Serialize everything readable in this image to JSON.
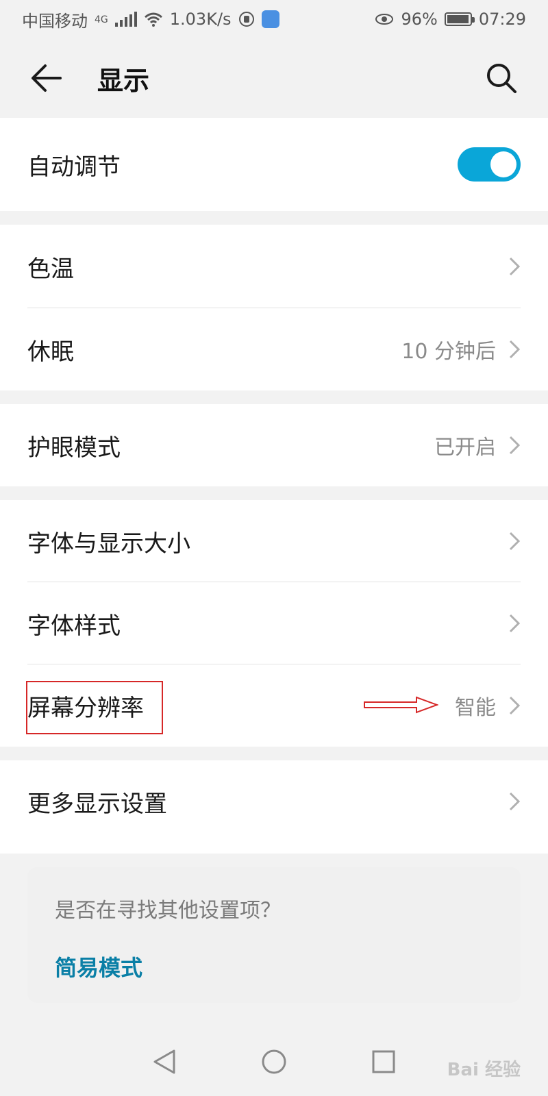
{
  "status": {
    "carrier": "中国移动",
    "network": "4G",
    "speed": "1.03K/s",
    "battery": "96%",
    "battery_level": 0.96,
    "time": "07:29"
  },
  "appbar": {
    "title": "显示",
    "back_icon": "arrow-left-icon",
    "search_icon": "search-icon"
  },
  "settings": {
    "auto_adjust": {
      "label": "自动调节",
      "enabled": true
    },
    "color_temp": {
      "label": "色温"
    },
    "sleep": {
      "label": "休眠",
      "value": "10 分钟后"
    },
    "eye_comfort": {
      "label": "护眼模式",
      "value": "已开启"
    },
    "font_size": {
      "label": "字体与显示大小"
    },
    "font_style": {
      "label": "字体样式"
    },
    "resolution": {
      "label": "屏幕分辨率",
      "value": "智能"
    },
    "more_display": {
      "label": "更多显示设置"
    }
  },
  "suggestion": {
    "question": "是否在寻找其他设置项？",
    "link": "简易模式"
  },
  "watermark": "Bai 经验",
  "colors": {
    "accent": "#0aa6d8",
    "link": "#0a7fa6",
    "highlight": "#d62828"
  }
}
